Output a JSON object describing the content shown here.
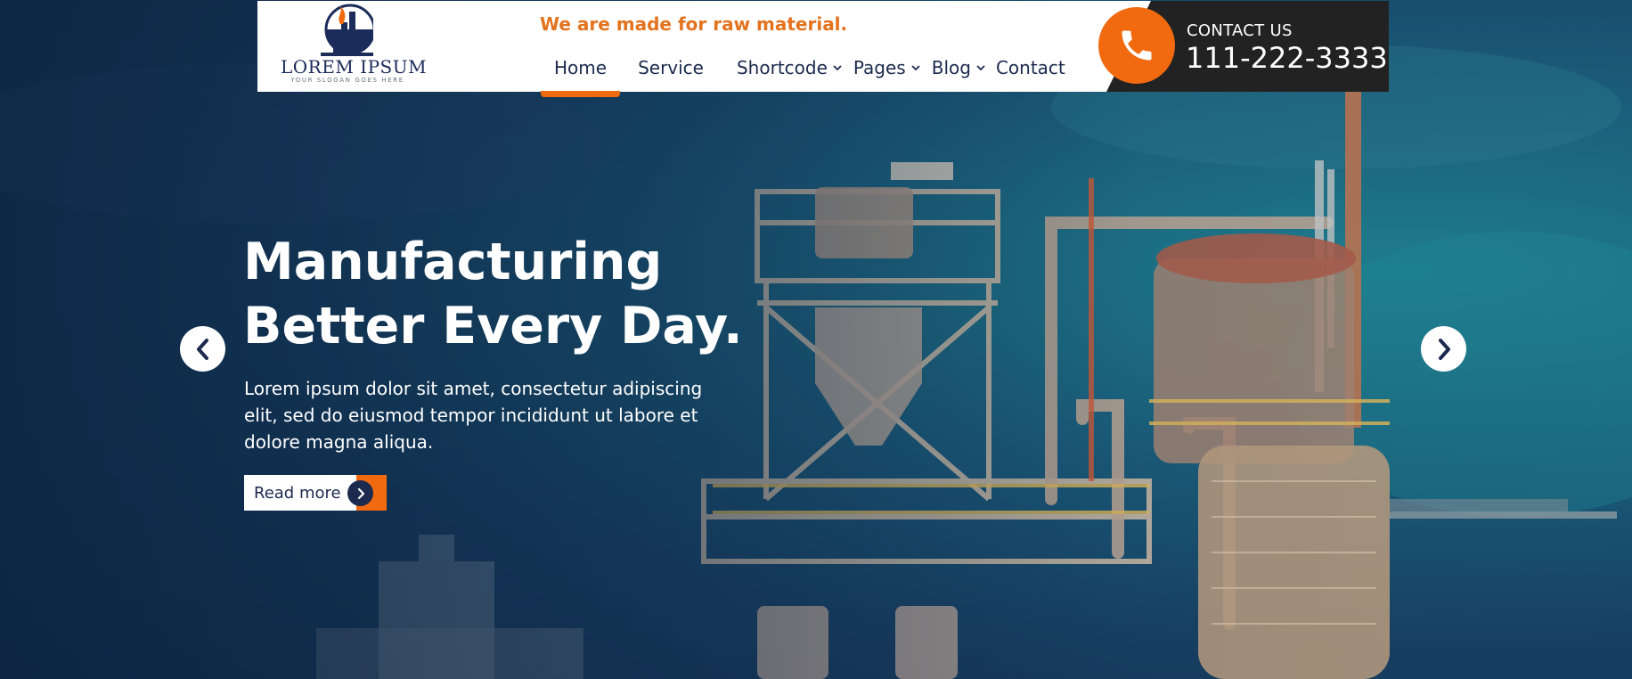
{
  "header": {
    "logo": {
      "name": "LOREM IPSUM",
      "slogan": "YOUR SLOGAN GOES HERE"
    },
    "tagline": "We are made for raw material.",
    "nav": [
      {
        "label": "Home",
        "active": true
      },
      {
        "label": "Service"
      },
      {
        "label": "Shortcode",
        "has_dropdown": true
      },
      {
        "label": "Pages",
        "has_dropdown": true
      },
      {
        "label": "Blog",
        "has_dropdown": true
      },
      {
        "label": "Contact"
      }
    ],
    "contact": {
      "label": "CONTACT US",
      "phone": "111-222-3333",
      "icon": "phone-icon"
    }
  },
  "hero": {
    "title_line1": "Manufacturing",
    "title_line2": "Better Every Day.",
    "description": "Lorem ipsum dolor sit amet, consectetur adipiscing elit, sed do eiusmod tempor incididunt ut labore et dolore magna aliqua.",
    "cta_label": "Read more",
    "prev_icon": "chevron-left-icon",
    "next_icon": "chevron-right-icon"
  },
  "colors": {
    "accent": "#f26a10",
    "tagline": "#e3731e",
    "navy": "#1b2a4e",
    "contact_bg": "#222222"
  }
}
